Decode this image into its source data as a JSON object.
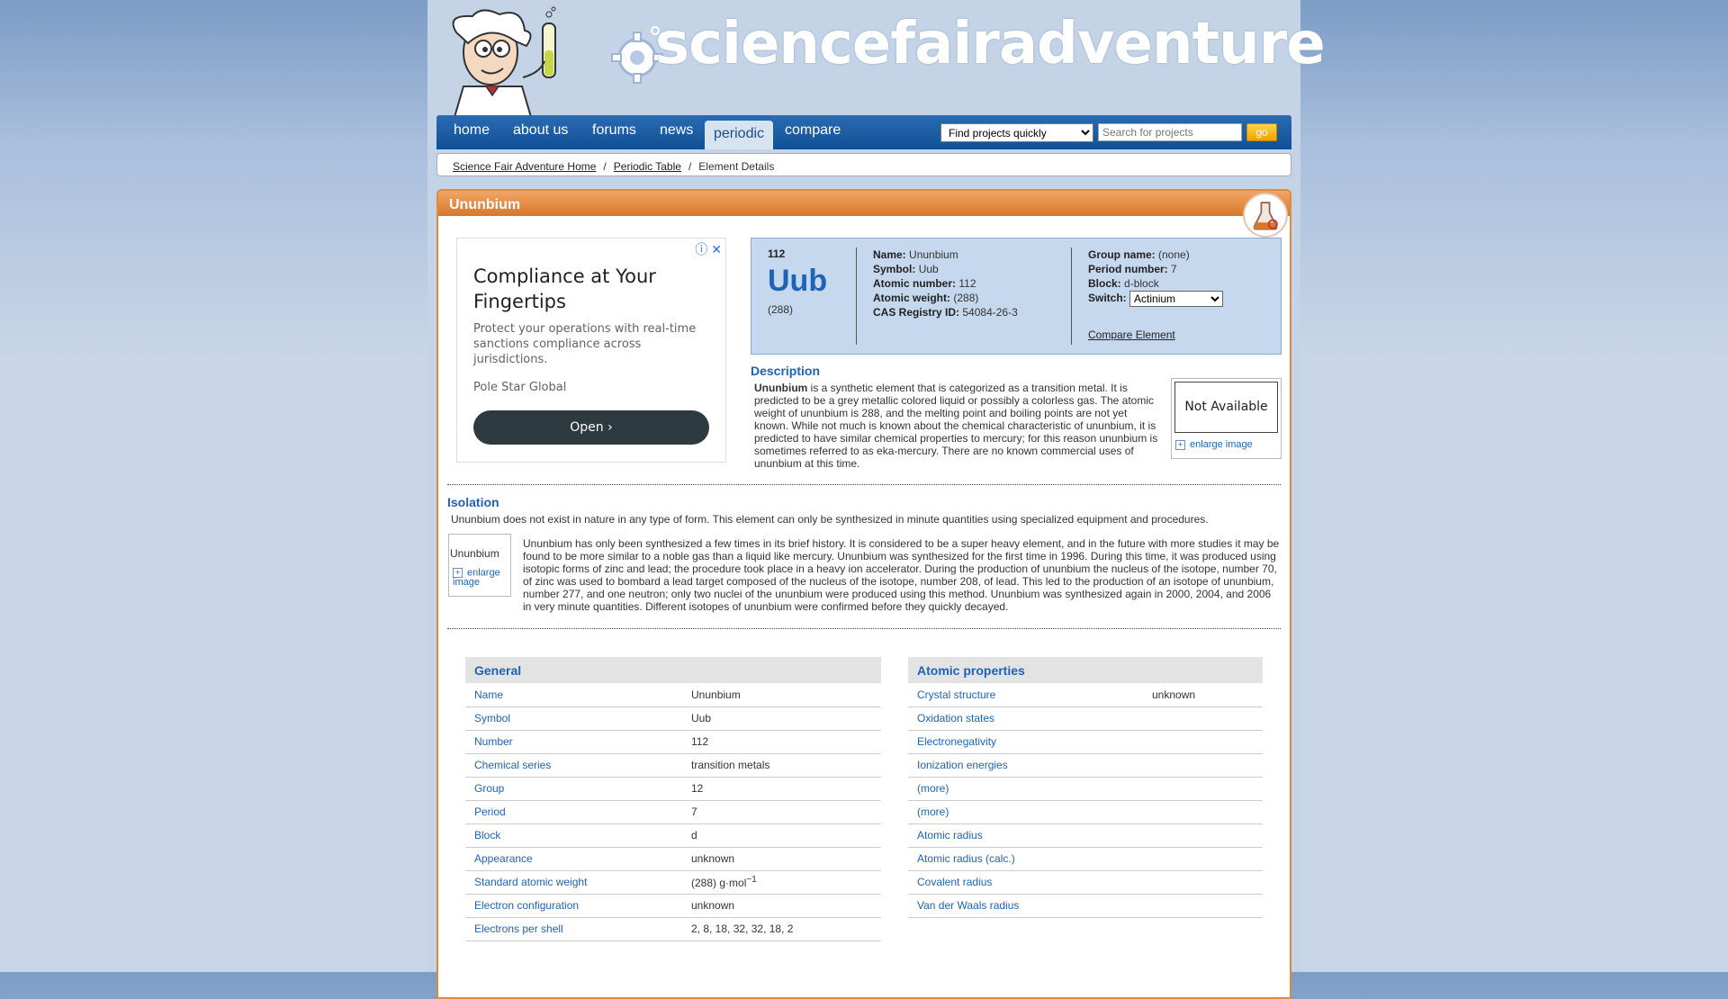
{
  "site": {
    "logo_text": "sciencefairadventure"
  },
  "nav": {
    "items": [
      "home",
      "about us",
      "forums",
      "news",
      "periodic",
      "compare"
    ],
    "active": "periodic",
    "find_select": "Find projects quickly",
    "search_placeholder": "Search for projects",
    "go_label": "go"
  },
  "breadcrumb": {
    "home": "Science Fair Adventure Home",
    "sep": "/",
    "periodic": "Periodic Table",
    "current": "Element Details"
  },
  "panel": {
    "title": "Ununbium"
  },
  "ad": {
    "title": "Compliance at Your Fingertips",
    "body": "Protect your operations with real-time sanctions compliance across jurisdictions.",
    "advertiser": "Pole Star Global",
    "cta": "Open",
    "info_icon": "ⓘ",
    "close_icon": "✕"
  },
  "element": {
    "number": "112",
    "symbol": "Uub",
    "weight": "(288)",
    "name_label": "Name:",
    "name": "Ununbium",
    "symbol_label": "Symbol:",
    "symbol_value": "Uub",
    "atomic_number_label": "Atomic number:",
    "atomic_number": "112",
    "atomic_weight_label": "Atomic weight:",
    "atomic_weight": "(288)",
    "cas_label": "CAS Registry ID:",
    "cas": "54084-26-3",
    "group_name_label": "Group name:",
    "group_name": "(none)",
    "period_label": "Period number:",
    "period": "7",
    "block_label": "Block:",
    "block": "d-block",
    "switch_label": "Switch:",
    "switch_value": "Actinium",
    "compare_link": "Compare Element"
  },
  "description": {
    "heading": "Description",
    "lead_bold": "Ununbium",
    "text": " is a synthetic element that is categorized as a transition metal. It is predicted to be a grey metallic colored liquid or possibly a colorless gas. The atomic weight of ununbium is 288, and the melting point and boiling points are not yet known. While not much is known about the chemical characteristic of ununbium, it is predicted to have similar chemical properties to mercury; for this reason ununbium is sometimes referred to as eka-mercury. There are no known commercial uses of ununbium at this time.",
    "image_placeholder": "Not Available",
    "enlarge": "enlarge image"
  },
  "isolation": {
    "heading": "Isolation",
    "lead": "Ununbium does not exist in nature in any type of form. This element can only be synthesized in minute quantities using specialized equipment and procedures.",
    "thumb_alt": "Ununbium",
    "enlarge": "enlarge image",
    "text": "Ununbium has only been synthesized a few times in its brief history. It is considered to be a super heavy element, and in the future with more studies it may be found to be more similar to a noble gas than a liquid like mercury. Ununbium was synthesized for the first time in 1996. During this time, it was produced using isotopic forms of zinc and lead; the procedure took place in a heavy ion accelerator. During the production of ununbium the nucleus of the isotope, number 70, of zinc was used to bombard a lead target composed of the nucleus of the isotope, number 208, of lead. This led to the production of an isotope of ununbium, number 277, and one neutron; only two nuclei of the ununbium were produced using this method. Ununbium was synthesized again in 2000, 2004, and 2006 in very minute quantities. Different isotopes of ununbium were confirmed before they quickly decayed."
  },
  "general": {
    "heading": "General",
    "rows": [
      {
        "k": "Name",
        "v": "Ununbium"
      },
      {
        "k": "Symbol",
        "v": "Uub"
      },
      {
        "k": "Number",
        "v": "112"
      },
      {
        "k": "Chemical series",
        "v": "transition metals"
      },
      {
        "k": "Group",
        "v": "12"
      },
      {
        "k": "Period",
        "v": "7"
      },
      {
        "k": "Block",
        "v": "d"
      },
      {
        "k": "Appearance",
        "v": "unknown"
      },
      {
        "k": "Standard atomic weight",
        "v": "(288)  g·mol",
        "sup": "−1"
      },
      {
        "k": "Electron configuration",
        "v": "unknown"
      },
      {
        "k": "Electrons per shell",
        "v": "2, 8, 18, 32, 32, 18, 2"
      }
    ]
  },
  "atomic": {
    "heading": "Atomic properties",
    "rows": [
      {
        "k": "Crystal structure",
        "v": "unknown"
      },
      {
        "k": "Oxidation states",
        "v": ""
      },
      {
        "k": "Electronegativity",
        "v": ""
      },
      {
        "k": "Ionization energies",
        "v": ""
      },
      {
        "k": "(more)",
        "v": ""
      },
      {
        "k": "(more)",
        "v": ""
      },
      {
        "k": "Atomic radius",
        "v": ""
      },
      {
        "k": "Atomic radius (calc.)",
        "v": ""
      },
      {
        "k": "Covalent radius",
        "v": ""
      },
      {
        "k": "Van der Waals radius",
        "v": ""
      }
    ]
  },
  "colors": {
    "accent_blue": "#1e63b6",
    "panel_orange": "#e08a3c",
    "nav_blue": "#1a5ea8"
  }
}
